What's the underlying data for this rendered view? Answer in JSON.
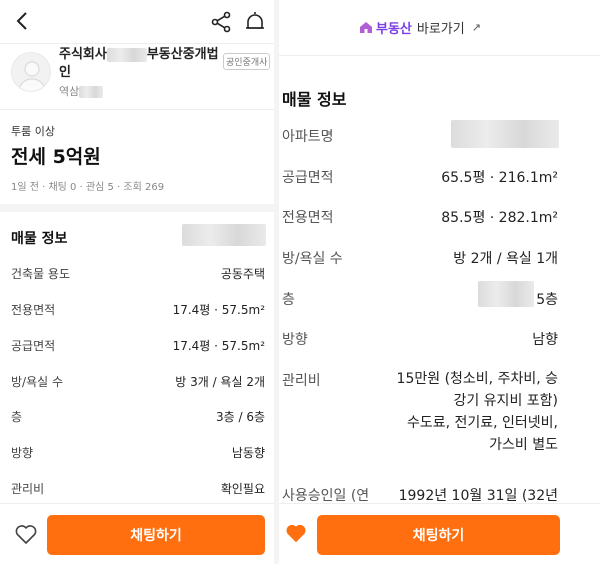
{
  "left": {
    "agent": {
      "name_line1": "주식회사",
      "name_suffix": "부동산중개법",
      "name_line2": "인",
      "sub": "역삼",
      "badge": "공인중개사"
    },
    "listing": {
      "room_type": "투룸 이상",
      "price": "전세 5억원",
      "meta": "1일 전 · 채팅 0 · 관심 5 · 조회 269"
    },
    "section_title": "매물 정보",
    "rows": [
      {
        "label": "건축물 용도",
        "value": "공동주택"
      },
      {
        "label": "전용면적",
        "value": "17.4평 · 57.5m²"
      },
      {
        "label": "공급면적",
        "value": "17.4평 · 57.5m²"
      },
      {
        "label": "방/욕실 수",
        "value": "방 3개 / 욕실 2개"
      },
      {
        "label": "층",
        "value": "3층 / 6층"
      },
      {
        "label": "방향",
        "value": "남동향"
      },
      {
        "label": "관리비",
        "value": "확인필요"
      }
    ],
    "chat_button": "채팅하기"
  },
  "right": {
    "brand": "부동산",
    "link_text": "바로가기",
    "section_title": "매물 정보",
    "apt_label": "아파트명",
    "rows": [
      {
        "label": "공급면적",
        "value": "65.5평 · 216.1m²"
      },
      {
        "label": "전용면적",
        "value": "85.5평 · 282.1m²"
      },
      {
        "label": "방/욕실 수",
        "value": "방 2개 / 욕실 1개"
      },
      {
        "label": "층",
        "value": "5층"
      },
      {
        "label": "방향",
        "value": "남향"
      }
    ],
    "fee_label": "관리비",
    "fee_lines": [
      "15만원 (청소비, 주차비, 승",
      "강기 유지비 포함)",
      "수도료, 전기료, 인터넷비,",
      "가스비 별도"
    ],
    "approval_label": "사용승인일 (연",
    "approval_value": "1992년 10월 31일 (32년",
    "chat_button": "채팅하기"
  },
  "colors": {
    "accent": "#ff6f0f",
    "brand_purple": "#7b3fe4"
  }
}
